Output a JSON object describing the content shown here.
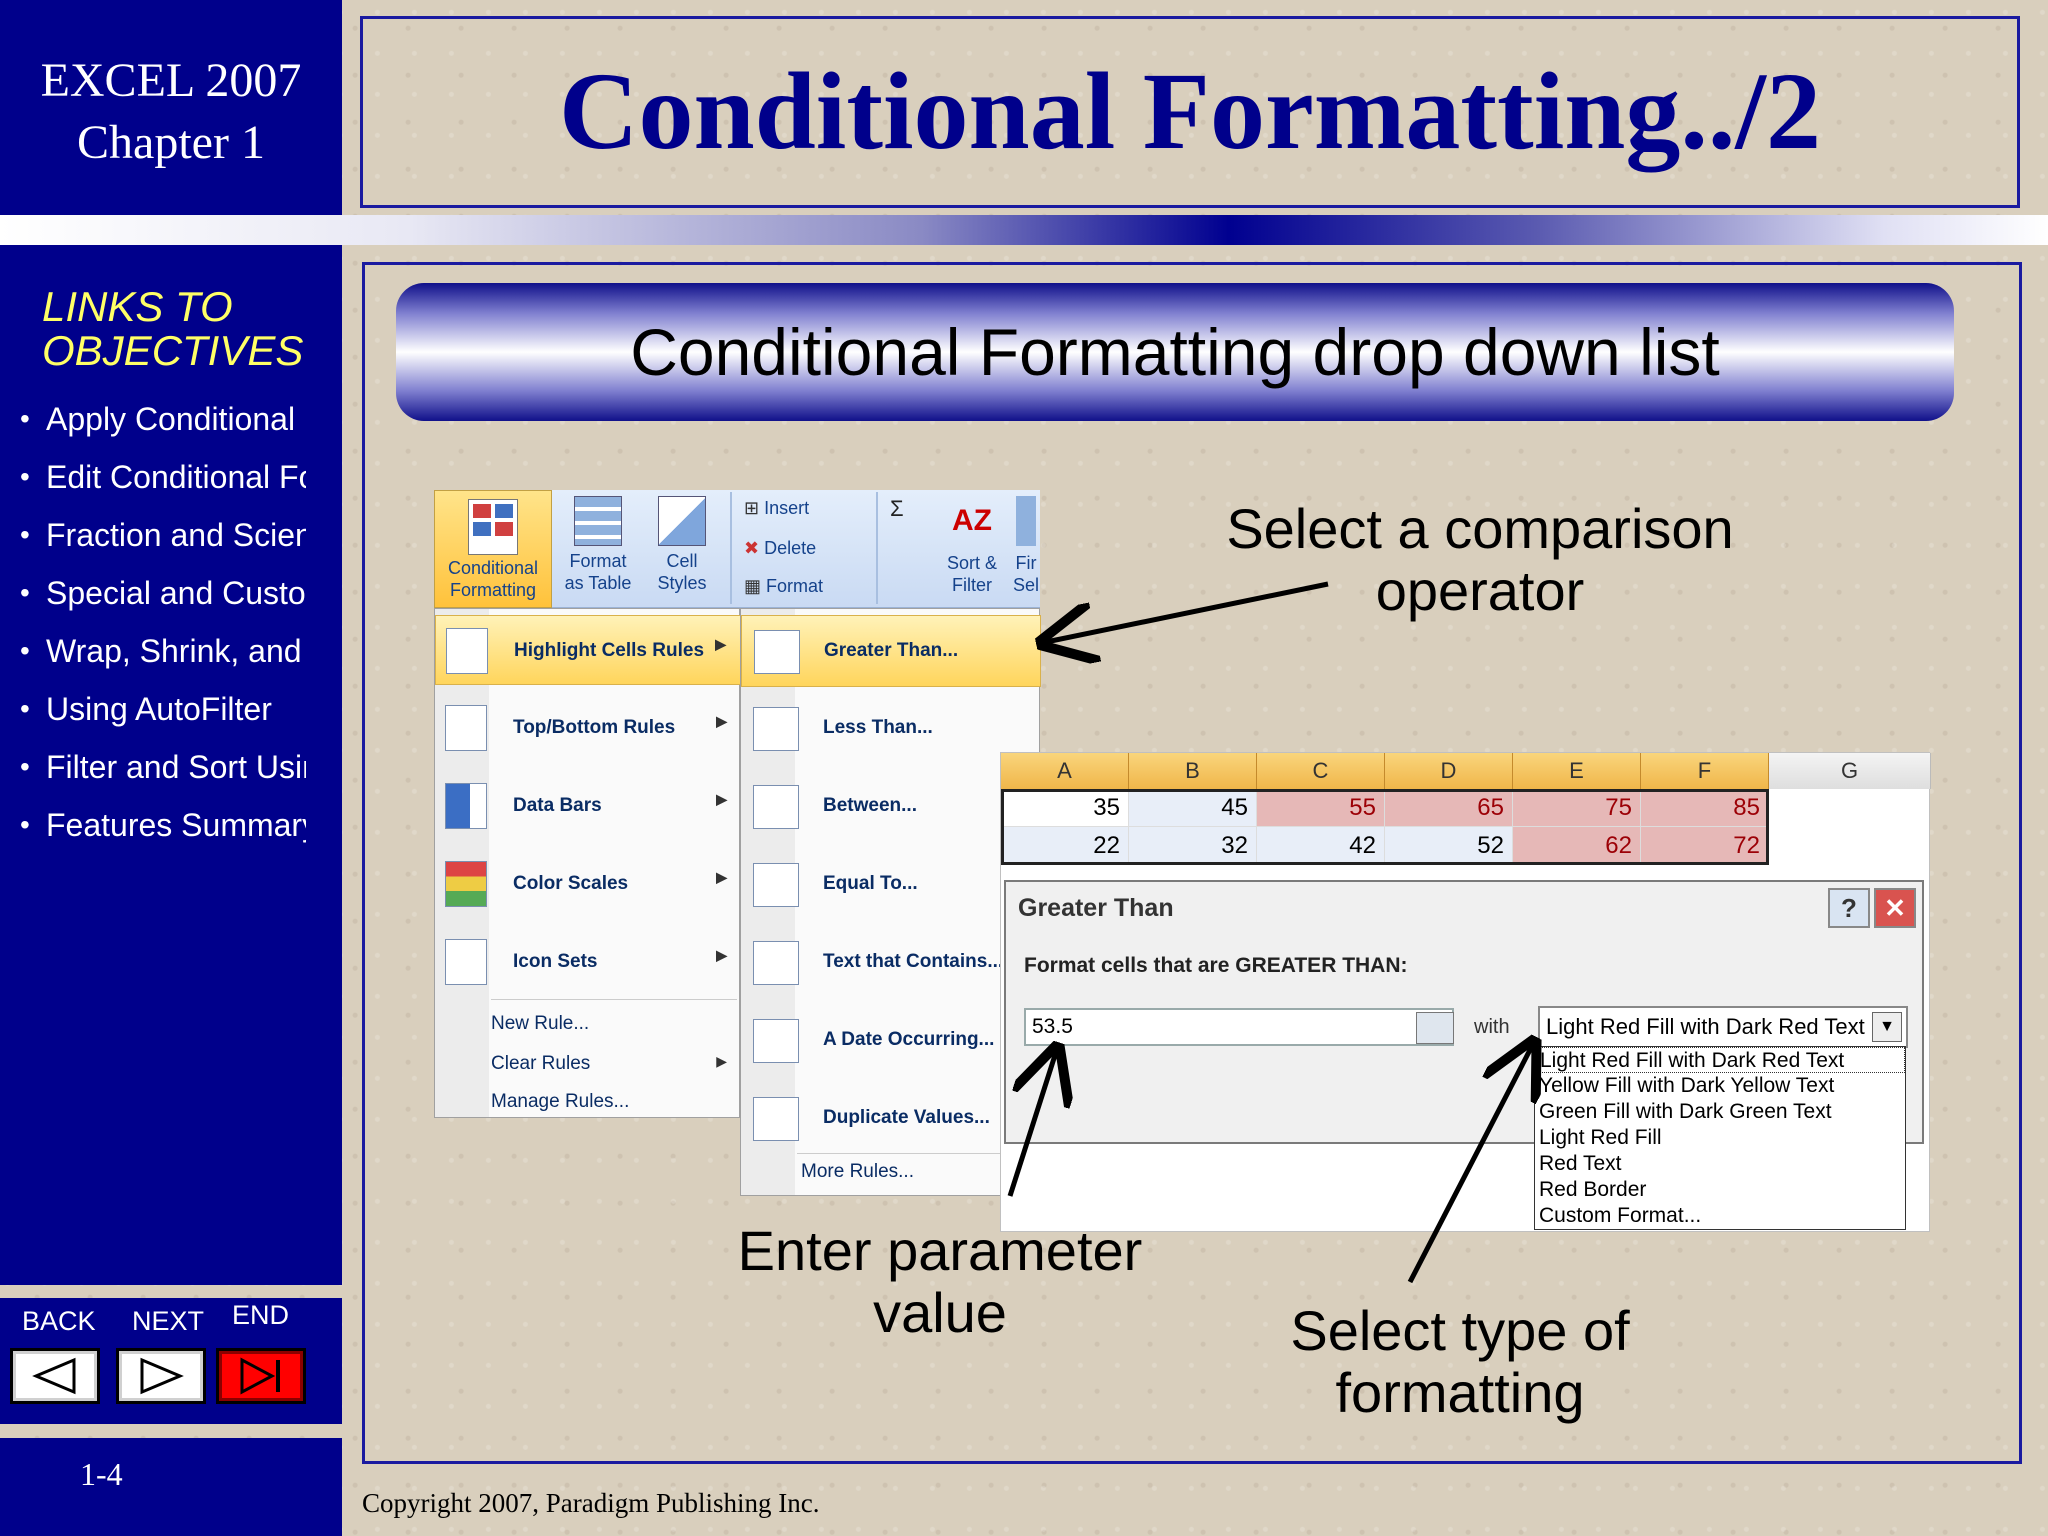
{
  "sidebar": {
    "course_line1": "EXCEL 2007",
    "course_line2": "Chapter 1",
    "links_heading_line1": "LINKS TO",
    "links_heading_line2": "OBJECTIVES",
    "objectives": [
      "Apply Conditional Fo",
      "Edit Conditional Forn",
      "Fraction and Scientifi",
      "Special and Custom",
      "Wrap, Shrink, and Mi",
      "Using AutoFilter",
      "Filter and Sort Using",
      "Features Summary"
    ],
    "nav": {
      "back": "BACK",
      "next": "NEXT",
      "end": "END"
    },
    "page_number": "1-4"
  },
  "slide": {
    "title": "Conditional Formatting../2",
    "subtitle": "Conditional Formatting drop down list",
    "copyright": "Copyright 2007, Paradigm Publishing Inc."
  },
  "ribbon": {
    "conditional_formatting": [
      "Conditional",
      "Formatting"
    ],
    "format_as_table": [
      "Format",
      "as Table"
    ],
    "cell_styles": [
      "Cell",
      "Styles"
    ],
    "insert": "Insert",
    "delete": "Delete",
    "format": "Format",
    "sort_filter": [
      "Sort &",
      "Filter"
    ],
    "find_select": [
      "Fir",
      "Sel"
    ]
  },
  "menu_main": {
    "items": [
      "Highlight Cells Rules",
      "Top/Bottom Rules",
      "Data Bars",
      "Color Scales",
      "Icon Sets"
    ],
    "small_items": [
      "New Rule...",
      "Clear Rules",
      "Manage Rules..."
    ]
  },
  "menu_sub": {
    "items": [
      "Greater Than...",
      "Less Than...",
      "Between...",
      "Equal To...",
      "Text that Contains...",
      "A Date Occurring...",
      "Duplicate Values..."
    ],
    "more": "More Rules..."
  },
  "sheet": {
    "columns": [
      "A",
      "B",
      "C",
      "D",
      "E",
      "F",
      "G"
    ],
    "row1": [
      "35",
      "45",
      "55",
      "65",
      "75",
      "85"
    ],
    "row2": [
      "22",
      "32",
      "42",
      "52",
      "62",
      "72"
    ]
  },
  "dialog": {
    "title": "Greater Than",
    "instruction": "Format cells that are GREATER THAN:",
    "value": "53.5",
    "with_label": "with",
    "selected_format": "Light Red Fill with Dark Red Text",
    "options": [
      "Light Red Fill with Dark Red Text",
      "Yellow Fill with Dark Yellow Text",
      "Green Fill with Dark Green Text",
      "Light Red Fill",
      "Red Text",
      "Red Border",
      "Custom Format..."
    ]
  },
  "callouts": {
    "operator_line1": "Select a comparison",
    "operator_line2": "operator",
    "parameter_line1": "Enter parameter",
    "parameter_line2": "value",
    "type_line1": "Select type of",
    "type_line2": "formatting"
  },
  "colors": {
    "sidebar_blue": "#00008b",
    "title_blue": "#00008b",
    "links_yellow": "#ffff66",
    "highlight_red": "#e6b8b7"
  }
}
